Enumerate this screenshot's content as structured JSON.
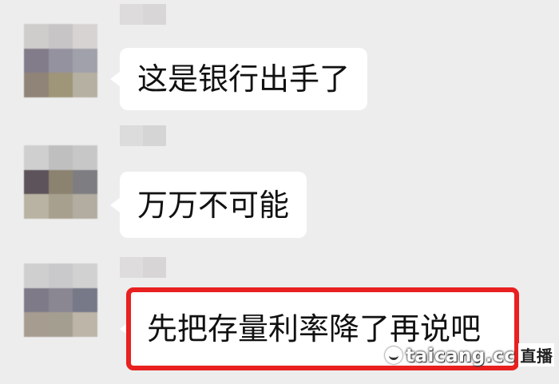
{
  "messages": [
    {
      "text": "这是银行出手了",
      "avatar_colors": [
        "#cfcccc",
        "#c7c5c6",
        "#d6d3d2",
        "#827c8a",
        "#95929f",
        "#a1a1ab",
        "#908478",
        "#9f9578",
        "#b5b0a1"
      ],
      "name_colors": [
        "#dddbdb",
        "#d8d6d6"
      ]
    },
    {
      "text": "万万不可能",
      "avatar_colors": [
        "#cfcfcf",
        "#bfbfbf",
        "#c7c7c7",
        "#5c545a",
        "#8c8270",
        "#7e7e82",
        "#b9b3a3",
        "#a8a08e",
        "#b2ada0"
      ],
      "name_colors": [
        "#dcdcdc",
        "#d5d5d5"
      ]
    },
    {
      "text": "先把存量利率降了再说吧",
      "avatar_colors": [
        "#d0cfd0",
        "#c9c8ca",
        "#d2d1d1",
        "#7f7a88",
        "#8a8692",
        "#777888",
        "#a69c90",
        "#a49e90",
        "#bcb5a8"
      ],
      "name_colors": [
        "#dedcdc",
        "#d7d5d5"
      ],
      "highlighted": true
    }
  ],
  "watermark": {
    "icon": "smiley-logo-icon",
    "text": "taicang.cc",
    "badge": "直播"
  },
  "colors": {
    "background": "#ededed",
    "bubble": "#ffffff",
    "highlight": "#e8201f"
  }
}
